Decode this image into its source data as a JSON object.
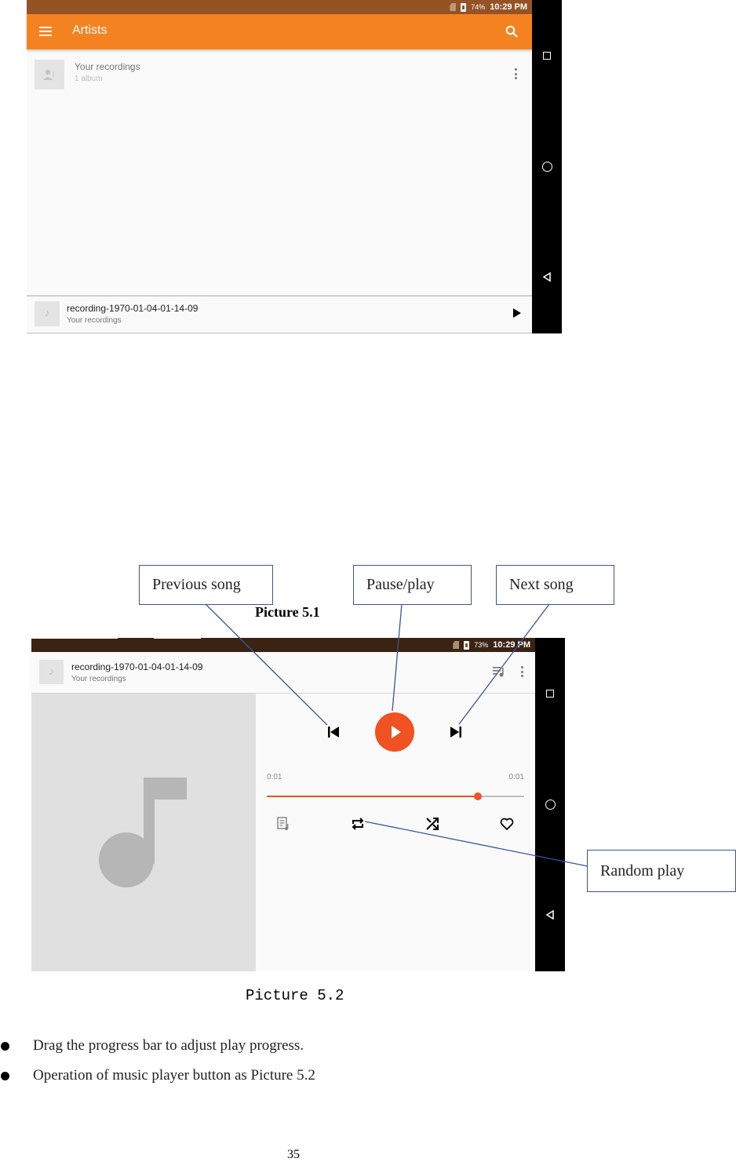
{
  "picture_5_1": {
    "status_bar": {
      "battery": "74%",
      "time": "10:29 PM"
    },
    "app_bar": {
      "title": "Artists",
      "menu_icon": "hamburger-icon",
      "search_icon": "search-icon"
    },
    "list": [
      {
        "title": "Your recordings",
        "subtitle": "1 album",
        "icon": "artist-placeholder-icon"
      }
    ],
    "now_playing": {
      "title": "recording-1970-01-04-01-14-09",
      "subtitle": "Your recordings",
      "play_icon": "play-icon"
    },
    "caption": "Picture 5.1"
  },
  "picture_5_2": {
    "status_bar": {
      "battery": "73%",
      "time": "10:29 PM"
    },
    "toolbar": {
      "title": "recording-1970-01-04-01-14-09",
      "subtitle": "Your recordings"
    },
    "player": {
      "elapsed": "0:01",
      "duration": "0:01",
      "progress_fraction": 0.82,
      "buttons": [
        "previous",
        "play",
        "next"
      ],
      "bottom_buttons": [
        "playlist",
        "repeat",
        "shuffle",
        "favorite"
      ]
    },
    "caption": "Picture 5.2"
  },
  "callouts": {
    "previous": "Previous song",
    "play": "Pause/play",
    "next": "Next song",
    "random": "Random play"
  },
  "bullets": [
    "Drag the progress bar to adjust play progress.",
    "Operation of music player button as Picture 5.2"
  ],
  "page_number": "35",
  "colors": {
    "accent": "#f58220",
    "play_red": "#f05223",
    "callout_line": "#3a55a0"
  }
}
